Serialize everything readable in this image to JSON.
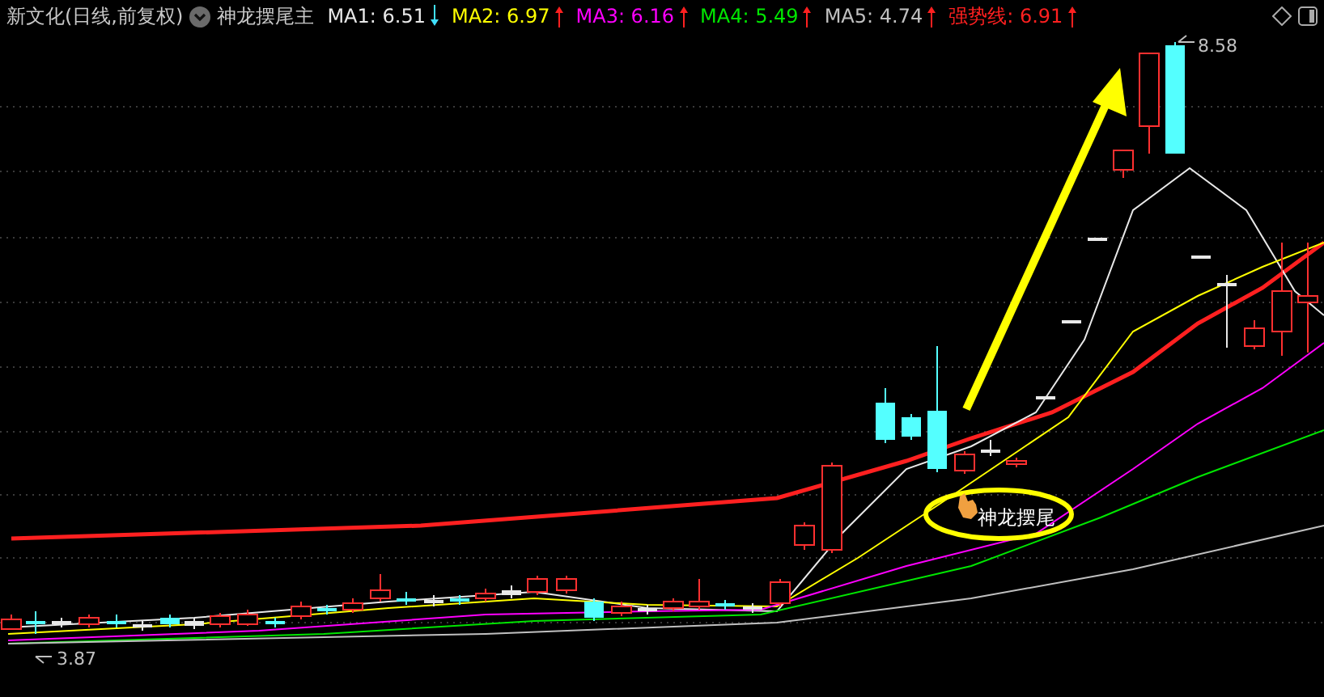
{
  "header": {
    "title": "新文化(日线,前复权)",
    "indicator": "神龙摆尾主",
    "lines": [
      {
        "text": "MA1: 6.51",
        "color": "#e8e8e8",
        "rising": false
      },
      {
        "text": "MA2: 6.97",
        "color": "#ffff00",
        "rising": true
      },
      {
        "text": "MA3: 6.16",
        "color": "#ff00ff",
        "rising": true
      },
      {
        "text": "MA4: 5.49",
        "color": "#00e600",
        "rising": true
      },
      {
        "text": "MA5: 4.74",
        "color": "#c0c0c0",
        "rising": true
      },
      {
        "text": "强势线: 6.91",
        "color": "#ff2020",
        "rising": true
      }
    ]
  },
  "chart": {
    "high_label": "8.58",
    "low_label": "3.87",
    "annotation": "神龙摆尾"
  }
}
